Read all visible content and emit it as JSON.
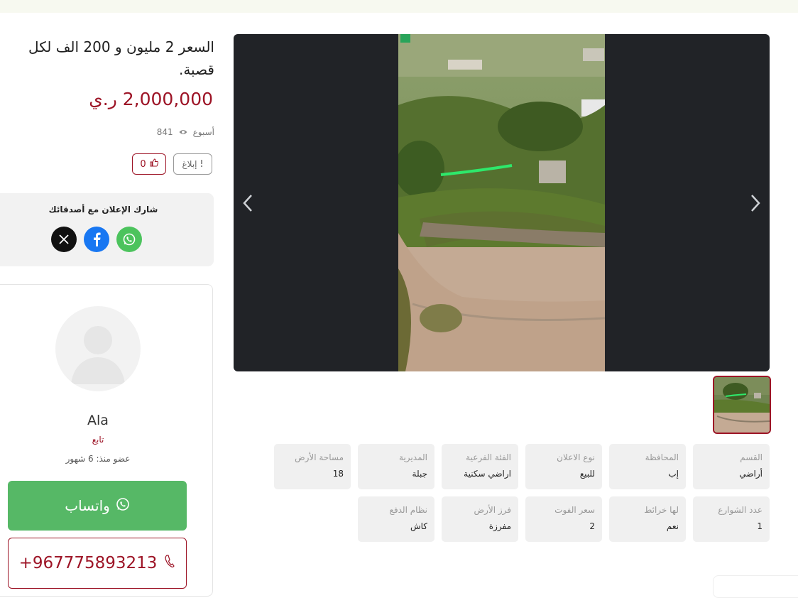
{
  "listing": {
    "title": "السعر 2 مليون و 200 الف لكل قصبة.",
    "price": "2,000,000 ر.ي",
    "time_ago": "أسبوع",
    "views": "841",
    "likes": "0",
    "report_label": "إبلاغ"
  },
  "share": {
    "title": "شارك الإعلان مع أصدقائك",
    "icons": [
      "x-icon",
      "facebook-icon",
      "whatsapp-icon"
    ]
  },
  "seller": {
    "name": "Ala",
    "follow_label": "تابع",
    "member_since": "عضو منذ: 6 شهور",
    "whatsapp_label": "واتساب",
    "phone": "+967775893213"
  },
  "attributes": [
    {
      "label": "القسم",
      "value": "أراضي"
    },
    {
      "label": "المحافظة",
      "value": "إب"
    },
    {
      "label": "نوع الاعلان",
      "value": "للبيع"
    },
    {
      "label": "الفئة الفرعية",
      "value": "اراضي سكنية"
    },
    {
      "label": "المديرية",
      "value": "جبلة"
    },
    {
      "label": "مساحة الأرض",
      "value": "18"
    },
    {
      "label": "عدد الشوارع",
      "value": "1"
    },
    {
      "label": "لها خرائط",
      "value": "نعم"
    },
    {
      "label": "سعر الفوت",
      "value": "2"
    },
    {
      "label": "فرز الأرض",
      "value": "مفرزة"
    },
    {
      "label": "نظام الدفع",
      "value": "كاش"
    }
  ],
  "colors": {
    "accent": "#9d1426",
    "whatsapp": "#56b866",
    "gallery_bg": "#212327",
    "chip_bg": "#f0f0f0"
  }
}
